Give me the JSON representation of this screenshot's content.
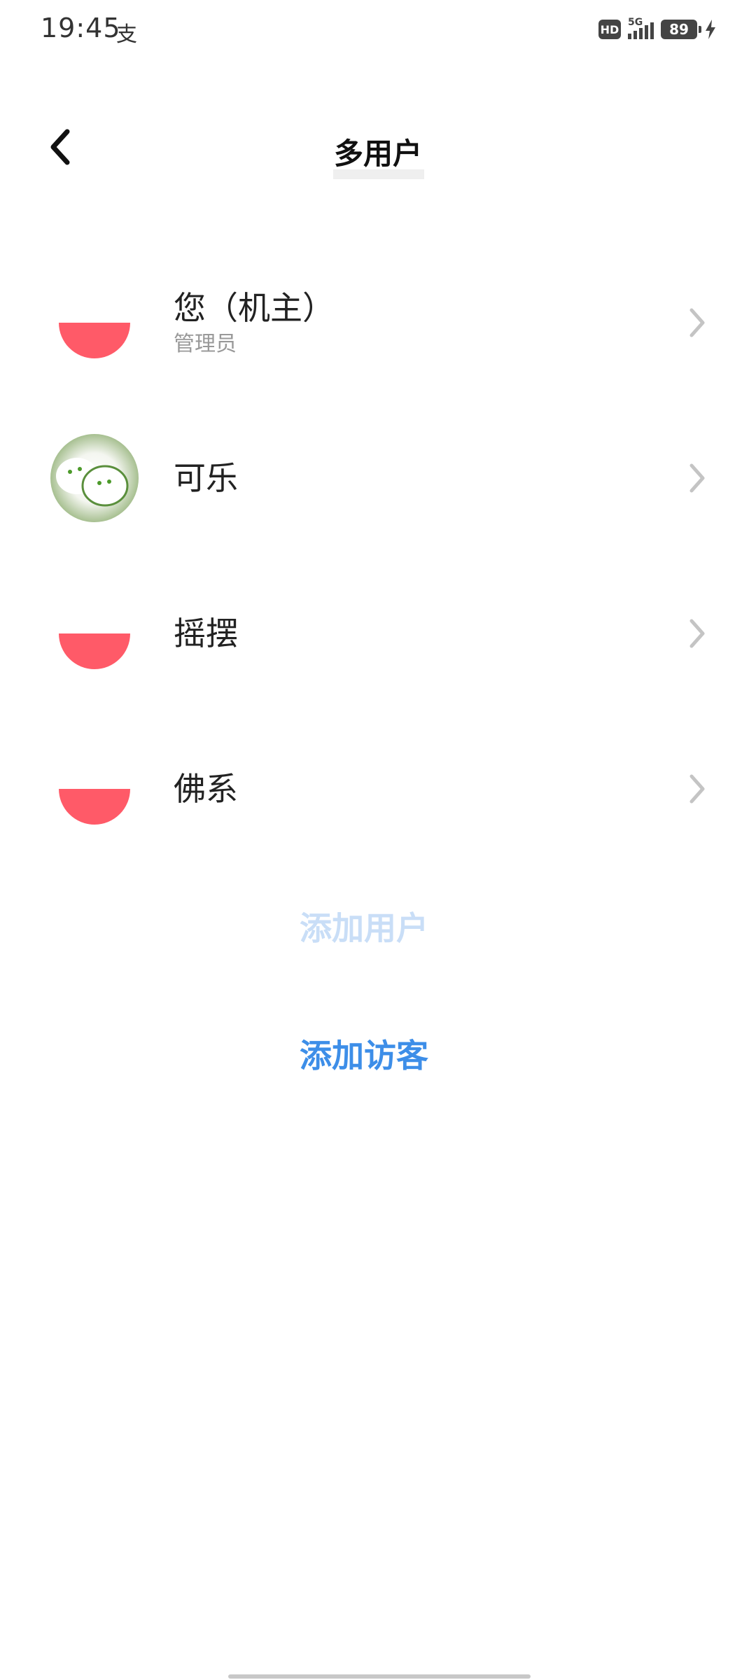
{
  "status_bar": {
    "time": "19:45",
    "app_icon_glyph": "支",
    "hd": "HD",
    "network": "5G",
    "battery": "89"
  },
  "header": {
    "title": "多用户"
  },
  "users": [
    {
      "name": "您（机主）",
      "role": "管理员",
      "avatar": "default"
    },
    {
      "name": "可乐",
      "role": "",
      "avatar": "photo"
    },
    {
      "name": "摇摆",
      "role": "",
      "avatar": "default"
    },
    {
      "name": "佛系",
      "role": "",
      "avatar": "default"
    }
  ],
  "actions": {
    "add_user": "添加用户",
    "add_guest": "添加访客"
  },
  "colors": {
    "avatar_default": "#ff5a68",
    "action_enabled": "#3d8ee8",
    "action_disabled": "#c9def7"
  }
}
